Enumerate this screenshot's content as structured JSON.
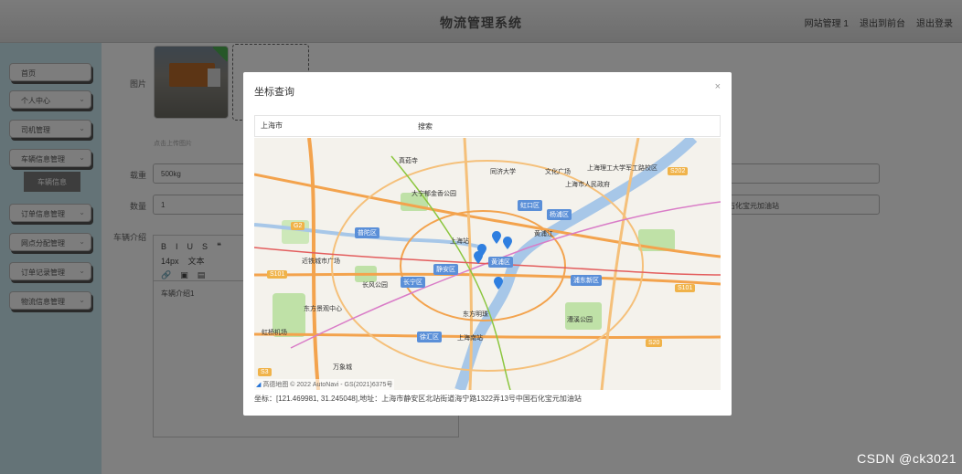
{
  "header": {
    "title": "物流管理系统",
    "links": [
      "网站管理 1",
      "退出到前台",
      "退出登录"
    ]
  },
  "sidebar": {
    "items": [
      {
        "label": "首页"
      },
      {
        "label": "个人中心",
        "chev": "⌄"
      },
      {
        "label": "司机管理",
        "chev": "⌄"
      },
      {
        "label": "车辆信息管理",
        "chev": "⌄"
      },
      {
        "label": "订单信息管理",
        "chev": "⌄"
      },
      {
        "label": "网点分配管理",
        "chev": "⌄"
      },
      {
        "label": "订单记录管理",
        "chev": "⌄"
      },
      {
        "label": "物流信息管理",
        "chev": "⌄"
      }
    ],
    "sub_item": "车辆信息"
  },
  "form": {
    "photo_label": "图片",
    "upload_hint": "点击上传图片",
    "load_label": "载重",
    "load_value": "500kg",
    "count_label": "数量",
    "count_value": "1",
    "address_tail": "石化宝元加油站",
    "intro_label": "车辆介绍",
    "toolbar": {
      "row1": [
        "B",
        "I",
        "U",
        "S",
        "❝"
      ],
      "size": "14px",
      "text": "文本",
      "row3": [
        "🔗",
        "▣",
        "▤"
      ]
    },
    "editor_text": "车辆介绍1"
  },
  "modal": {
    "title": "坐标查询",
    "close": "×",
    "search_value": "上海市",
    "search_button": "搜索",
    "map_footer": "高德地图 © 2022 AutoNavi - GS(2021)6375号",
    "coord_text": "坐标：[121.469981, 31.245048],地址：上海市静安区北站街道海宁路1322弄13号中国石化宝元加油站"
  },
  "map": {
    "labels": [
      {
        "text": "真茹寺"
      },
      {
        "text": "同济大学"
      },
      {
        "text": "文化广场"
      },
      {
        "text": "上海理工大学军工路校区"
      },
      {
        "text": "S202"
      },
      {
        "text": "上海市人民政府"
      },
      {
        "text": "大宁郁金香公园"
      },
      {
        "text": "虹口区"
      },
      {
        "text": "杨浦区"
      },
      {
        "text": "G2"
      },
      {
        "text": "普陀区"
      },
      {
        "text": "上海站"
      },
      {
        "text": "黄浦江"
      },
      {
        "text": "近铁城市广场"
      },
      {
        "text": "静安区"
      },
      {
        "text": "黄浦区"
      },
      {
        "text": "浦东新区"
      },
      {
        "text": "长宁区"
      },
      {
        "text": "长风公园"
      },
      {
        "text": "S101"
      },
      {
        "text": "S101"
      },
      {
        "text": "东方明珠"
      },
      {
        "text": "虹桥机场"
      },
      {
        "text": "东方景观中心"
      },
      {
        "text": "徐汇区"
      },
      {
        "text": "上海南站"
      },
      {
        "text": "万象城"
      },
      {
        "text": "漕溪公园"
      },
      {
        "text": "S3"
      },
      {
        "text": "S20"
      }
    ]
  },
  "watermark": "CSDN @ck3021",
  "colors": {
    "sidebar": "#c9e6ee",
    "pin": "#2f7fe0",
    "road_major": "#f3a34d",
    "river": "#a7c7e8",
    "park": "#bfe1a7"
  }
}
